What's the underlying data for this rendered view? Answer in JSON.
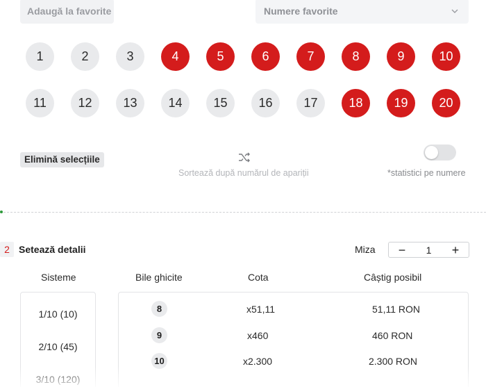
{
  "favorites": {
    "add_label": "Adaugă la favorite",
    "select_placeholder": "Numere favorite"
  },
  "numbers": {
    "row1": [
      {
        "n": "1",
        "selected": false
      },
      {
        "n": "2",
        "selected": false
      },
      {
        "n": "3",
        "selected": false
      },
      {
        "n": "4",
        "selected": true
      },
      {
        "n": "5",
        "selected": true
      },
      {
        "n": "6",
        "selected": true
      },
      {
        "n": "7",
        "selected": true
      },
      {
        "n": "8",
        "selected": true
      },
      {
        "n": "9",
        "selected": true
      },
      {
        "n": "10",
        "selected": true
      }
    ],
    "row2": [
      {
        "n": "11",
        "selected": false
      },
      {
        "n": "12",
        "selected": false
      },
      {
        "n": "13",
        "selected": false
      },
      {
        "n": "14",
        "selected": false
      },
      {
        "n": "15",
        "selected": false
      },
      {
        "n": "16",
        "selected": false
      },
      {
        "n": "17",
        "selected": false
      },
      {
        "n": "18",
        "selected": true
      },
      {
        "n": "19",
        "selected": true
      },
      {
        "n": "20",
        "selected": true
      }
    ]
  },
  "controls": {
    "clear_label": "Elimină selecțiile",
    "sort_label": "Sortează după numărul de apariții",
    "stats_label": "*statistici pe numere",
    "stats_toggle_on": false
  },
  "details": {
    "step_number": "2",
    "title": "Setează detalii",
    "stake_label": "Miza",
    "stake_value": "1",
    "minus": "−",
    "plus": "+"
  },
  "table": {
    "headers": {
      "systems": "Sisteme",
      "balls": "Bile ghicite",
      "odds": "Cota",
      "win": "Câștig posibil"
    },
    "systems": [
      "1/10 (10)",
      "2/10 (45)",
      "3/10 (120)"
    ],
    "rows": [
      {
        "balls": "8",
        "odds": "x51,11",
        "win": "51,11 RON"
      },
      {
        "balls": "9",
        "odds": "x460",
        "win": "460 RON"
      },
      {
        "balls": "10",
        "odds": "x2.300",
        "win": "2.300 RON"
      }
    ]
  },
  "colors": {
    "selected_ball": "#d41c1c",
    "unselected_ball": "#e9eaec",
    "accent_step": "#d41c1c"
  }
}
